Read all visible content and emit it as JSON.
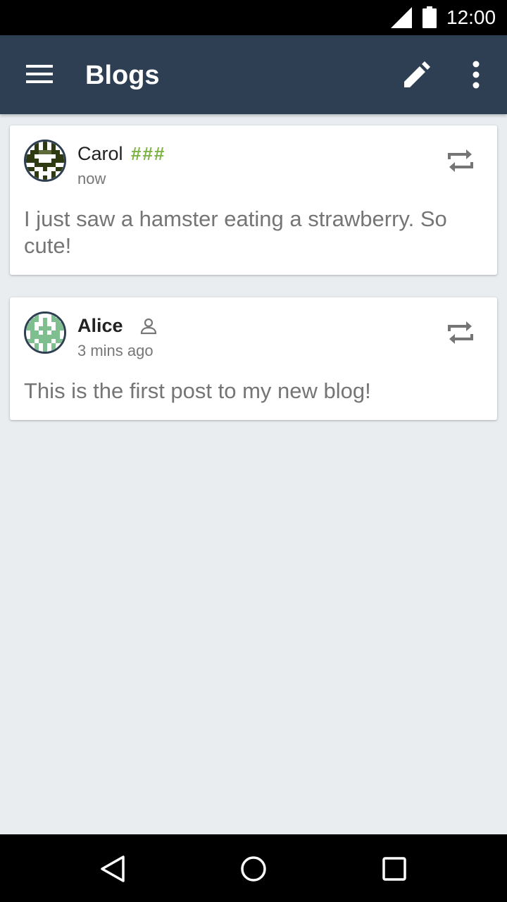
{
  "status_bar": {
    "time": "12:00",
    "signal_icon": "signal-icon",
    "battery_icon": "battery-icon"
  },
  "app_bar": {
    "title": "Blogs",
    "menu_icon": "menu-icon",
    "edit_icon": "pencil-icon",
    "overflow_icon": "more-vert-icon",
    "background": "#2f3f53"
  },
  "posts": [
    {
      "author": "Carol",
      "badge": "###",
      "badge_color": "#7cb342",
      "time": "now",
      "body": "I just saw a hamster eating a strawberry. So cute!",
      "repost_icon": "repost-icon"
    },
    {
      "author": "Alice",
      "badge_icon": "person-icon",
      "time": "3 mins ago",
      "body": "This is the first post to my new blog!",
      "repost_icon": "repost-icon"
    }
  ],
  "nav_bar": {
    "back_icon": "back-triangle-icon",
    "home_icon": "home-circle-icon",
    "recents_icon": "recents-square-icon"
  }
}
